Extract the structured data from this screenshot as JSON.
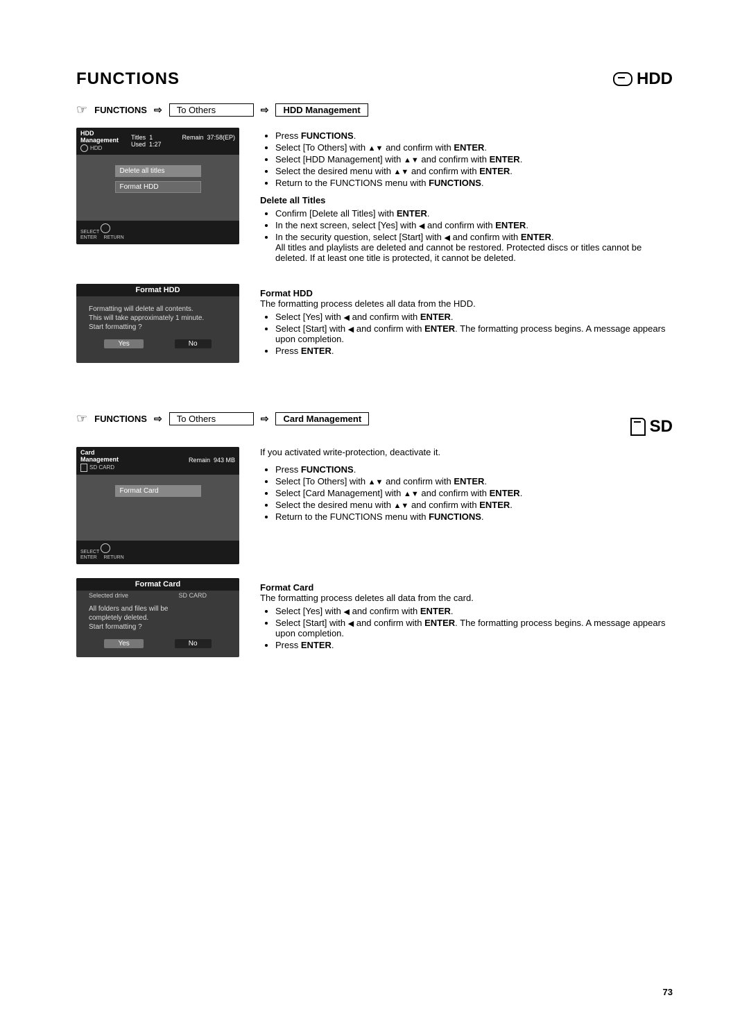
{
  "page_number": "73",
  "header": {
    "left": "FUNCTIONS",
    "right": "HDD"
  },
  "bc1": {
    "functions": "FUNCTIONS",
    "to_others": "To Others",
    "target": "HDD Management"
  },
  "osd1": {
    "title1": "HDD",
    "title2": "Management",
    "sub": "HDD",
    "titles_l": "Titles",
    "titles_v": "1",
    "used_l": "Used",
    "used_v": "1:27",
    "remain_l": "Remain",
    "remain_v": "37:58(EP)",
    "btn1": "Delete all titles",
    "btn2": "Format HDD",
    "fsel": "SELECT",
    "fent": "ENTER",
    "fret": "RETURN"
  },
  "osd2": {
    "title": "Format HDD",
    "line1": "Formatting will delete all contents.",
    "line2": "This will take approximately 1 minute.",
    "line3": "Start formatting ?",
    "yes": "Yes",
    "no": "No"
  },
  "instr1": {
    "b1": "Press ",
    "b1s": "FUNCTIONS",
    "b1e": ".",
    "b2a": "Select [To Others] with ",
    "b2b": " and confirm with ",
    "b2s": "ENTER",
    "b2e": ".",
    "b3a": "Select [HDD Management] with ",
    "b3b": " and confirm with ",
    "b3s": "ENTER",
    "b3e": ".",
    "b4a": "Select the desired menu with ",
    "b4b": " and confirm with ",
    "b4s": "ENTER",
    "b4e": ".",
    "b5a": "Return to the FUNCTIONS menu with ",
    "b5s": "FUNCTIONS",
    "b5e": ".",
    "h1": "Delete all Titles",
    "d1a": "Confirm [Delete all Titles] with ",
    "d1s": "ENTER",
    "d1e": ".",
    "d2a": "In the next screen, select [Yes] with ",
    "d2b": " and confirm with ",
    "d2s": "ENTER",
    "d2e": ".",
    "d3a": "In the security question, select [Start] with ",
    "d3b": " and confirm with ",
    "d3s": "ENTER",
    "d3e": ".",
    "d3f": "All titles and playlists are deleted and cannot be restored. Protected discs or titles cannot be deleted. If at least one title is protected, it cannot be deleted.",
    "h2": "Format HDD",
    "f0": "The formatting process deletes all data from the HDD.",
    "f1a": "Select [Yes] with ",
    "f1b": " and confirm with ",
    "f1s": "ENTER",
    "f1e": ".",
    "f2a": "Select [Start] with ",
    "f2b": " and confirm with ",
    "f2s": "ENTER",
    "f2e": ". The formatting process begins. A message appears upon completion.",
    "f3a": "Press ",
    "f3s": "ENTER",
    "f3e": "."
  },
  "sd_header": "SD",
  "bc2": {
    "functions": "FUNCTIONS",
    "to_others": "To Others",
    "target": "Card Management"
  },
  "osd3": {
    "title1": "Card",
    "title2": "Management",
    "sub": "SD CARD",
    "remain_l": "Remain",
    "remain_v": "943 MB",
    "btn1": "Format Card",
    "fsel": "SELECT",
    "fent": "ENTER",
    "fret": "RETURN"
  },
  "osd4": {
    "title": "Format Card",
    "drive_l": "Selected drive",
    "drive_v": "SD CARD",
    "line1": "All folders and files will be",
    "line2": "completely deleted.",
    "line3": "Start formatting ?",
    "yes": "Yes",
    "no": "No"
  },
  "instr2": {
    "pre": "If you activated write-protection, deactivate it.",
    "b1": "Press ",
    "b1s": "FUNCTIONS",
    "b1e": ".",
    "b2a": "Select [To Others] with ",
    "b2b": " and confirm with ",
    "b2s": "ENTER",
    "b2e": ".",
    "b3a": "Select [Card Management] with ",
    "b3b": " and confirm with ",
    "b3s": "ENTER",
    "b3e": ".",
    "b4a": "Select the desired menu with ",
    "b4b": " and confirm with ",
    "b4s": "ENTER",
    "b4e": ".",
    "b5a": "Return to the FUNCTIONS menu with ",
    "b5s": "FUNCTIONS",
    "b5e": ".",
    "h1": "Format Card",
    "f0": "The formatting process deletes all data from the card.",
    "f1a": "Select [Yes] with ",
    "f1b": " and confirm with ",
    "f1s": "ENTER",
    "f1e": ".",
    "f2a": "Select [Start] with ",
    "f2b": " and confirm with ",
    "f2s": "ENTER",
    "f2e": ". The formatting process begins. A message appears upon completion.",
    "f3a": "Press ",
    "f3s": "ENTER",
    "f3e": "."
  }
}
